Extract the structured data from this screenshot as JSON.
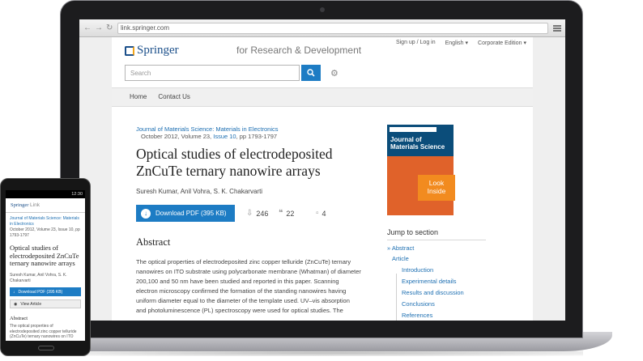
{
  "browser": {
    "url": "link.springer.com",
    "back_icon": "arrow-left-icon",
    "forward_icon": "arrow-right-icon",
    "refresh_icon": "refresh-icon"
  },
  "header": {
    "topbar": [
      "Sign up / Log in",
      "English",
      "Corporate Edition"
    ],
    "logo_text": "Springer",
    "tagline": "for Research & Development",
    "search_placeholder": "Search"
  },
  "nav": {
    "items": [
      "Home",
      "Contact Us"
    ]
  },
  "article": {
    "journal": "Journal of Materials Science: Materials in Electronics",
    "issue_prefix": "October 2012, Volume 23,",
    "issue_link": "Issue 10",
    "issue_suffix": ", pp 1793-1797",
    "title_line1": "Optical studies of electrodeposited",
    "title_line2": "ZnCuTe ternary nanowire arrays",
    "authors": "Suresh Kumar, Anil Vohra, S. K. Chakarvarti",
    "download_label": "Download PDF (395 KB)",
    "downloads": "246",
    "citations": "22",
    "comments": "4"
  },
  "abstract": {
    "heading": "Abstract",
    "lines": [
      "The optical properties of electrodeposited zinc copper telluride (ZnCuTe) ternary",
      "nanowires on ITO substrate using polycarbonate membrane (Whatman) of diameter",
      "200,100 and 50 nm have been studied and reported in this paper. Scanning",
      "electron microscopy confirmed the formation of the standing nanowires having",
      "uniform diameter equal to the diameter of the template used. UV–vis absorption",
      "and photoluminescence (PL) spectroscopy were used for optical studies. The"
    ]
  },
  "cover": {
    "line1": "Journal of",
    "line2": "Materials Science",
    "look_inside_1": "Look",
    "look_inside_2": "Inside"
  },
  "jump": {
    "heading": "Jump to section",
    "items": [
      "» Abstract",
      "Article",
      "Introduction",
      "Experimental details",
      "Results and discussion",
      "Conclusions",
      "References"
    ]
  },
  "phone": {
    "status": "12:30",
    "logo": "Springer",
    "logo_suffix": "Link",
    "journal_1": "Journal of Materials Science: Materials",
    "journal_2": "in Electronics",
    "issue_1": "October 2012, Volume 23, Issue 10, pp",
    "issue_2": "1793-1797",
    "title_1": "Optical studies of",
    "title_2": "electrodeposited ZnCuTe",
    "title_3": "ternary nanowire arrays",
    "authors_1": "Suresh Kumar, Anil Vohra, S. K.",
    "authors_2": "Chakarvarti",
    "download": "Download PDF (395 KB)",
    "view": "View Article",
    "abstract_head": "Abstract",
    "abs_1": "The optical properties of",
    "abs_2": "electrodeposited zinc copper telluride",
    "abs_3": "(ZnCuTe) ternary nanowires on ITO"
  },
  "colors": {
    "accent": "#1d7cc4",
    "brand": "#1b4f8a",
    "orange": "#f28b1f"
  }
}
